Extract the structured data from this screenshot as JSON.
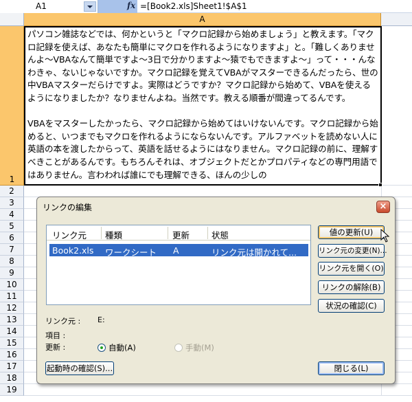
{
  "formula_bar": {
    "name_box": "A1",
    "fx_label": "fx",
    "formula": "=[Book2.xls]Sheet1!$A$1"
  },
  "grid": {
    "column_header": "A",
    "row_numbers": [
      "1",
      "2",
      "3",
      "4",
      "5",
      "6",
      "7",
      "8",
      "9",
      "10",
      "11",
      "12",
      "13",
      "14",
      "15",
      "16",
      "17",
      "18",
      "19"
    ],
    "cell_a1": {
      "paragraph1": "パソコン雑誌などでは、何かというと「マクロ記録から始めましょう」と教えます。「マクロ記録を使えば、あなたも簡単にマクロを作れるようになりますよ」と。「難しくありませんよ～VBAなんて簡単ですよ～3日で分かりますよ～猿でもできますよ～」って・・・んなわきゃ、ないじゃないですか。マクロ記録を覚えてVBAがマスターできるんだったら、世の中VBAマスターだらけですよ。実際はどうですか？マクロ記録から始めて、VBAを使えるようになりましたか？なりませんよね。当然です。教える順番が間違ってるんです。",
      "paragraph2": "VBAをマスターしたかったら、マクロ記録から始めてはいけないんです。マクロ記録から始めると、いつまでもマクロを作れるようにならないんです。アルファベットを読めない人に英語の本を渡したからって、英語を話せるようにはなりません。マクロ記録の前に、理解すべきことがあるんです。もちろんそれは、オブジェクトだとかプロパティなどの専門用語ではありません。言わわれば誰にでも理解できる、ほんの少しの"
    }
  },
  "dialog": {
    "title": "リンクの編集",
    "close_glyph": "×",
    "list": {
      "headers": {
        "source": "リンク元",
        "type": "種類",
        "update": "更新",
        "status": "状態"
      },
      "rows": [
        {
          "source": "Book2.xls",
          "type": "ワークシート",
          "update": "A",
          "status": "リンク元は開かれて..."
        }
      ]
    },
    "info": {
      "source_label": "リンク元 :",
      "source_value": "E:",
      "item_label": "項目 :",
      "update_label": "更新 :",
      "auto_label": "自動(A)",
      "manual_label": "手動(M)",
      "update_mode": "auto"
    },
    "buttons": {
      "update_values": "値の更新(U)",
      "change_source": "リンク元の変更(N)...",
      "open_source": "リンク元を開く(O)",
      "break_link": "リンクの解除(B)",
      "check_status": "状況の確認(C)",
      "startup_prompt": "起動時の確認(S)...",
      "close": "閉じる(L)"
    }
  }
}
